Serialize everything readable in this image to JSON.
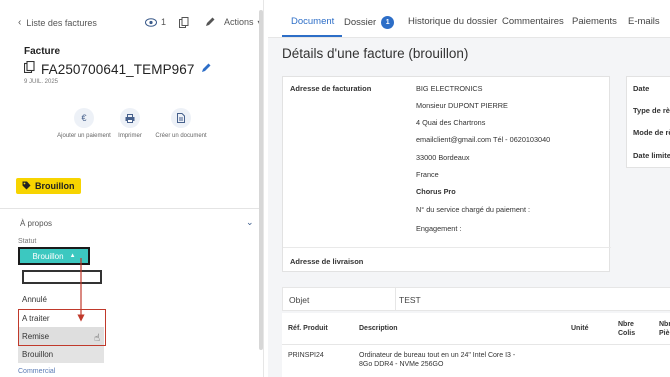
{
  "left": {
    "back_label": "Liste des factures",
    "followers_count": "1",
    "actions_label": "Actions",
    "invoice_type": "Facture",
    "invoice_id": "FA250700641_TEMP967",
    "invoice_date": "9 JUIL. 2025",
    "quick_actions": [
      {
        "label": "Ajouter un paiement",
        "icon": "euro-icon"
      },
      {
        "label": "Imprimer",
        "icon": "printer-icon"
      },
      {
        "label": "Créer un document",
        "icon": "document-icon"
      }
    ],
    "status_badge": "Brouillon",
    "section_title": "À propos",
    "status_label": "Statut",
    "status_value": "Brouillon",
    "status_options": [
      "Annulé",
      "A traiter",
      "Remise",
      "Brouillon"
    ],
    "next_section": "Commercial"
  },
  "tabs": [
    {
      "label": "Document",
      "active": true
    },
    {
      "label": "Dossier",
      "count": "1"
    },
    {
      "label": "Historique du dossier"
    },
    {
      "label": "Commentaires"
    },
    {
      "label": "Paiements"
    },
    {
      "label": "E-mails"
    }
  ],
  "page_title": "Détails d'une facture (brouillon)",
  "billing": {
    "label": "Adresse de facturation",
    "company": "BIG ELECTRONICS",
    "contact": "Monsieur DUPONT PIERRE",
    "street": "4 Quai des Chartrons",
    "email_phone": "emailclient@gmail.com Tél - 0620103040",
    "city": "33000 Bordeaux",
    "country": "France",
    "chorus": "Chorus Pro",
    "service_label": "N° du service chargé du paiement :",
    "engagement_label": "Engagement :"
  },
  "delivery_label": "Adresse de livraison",
  "side_fields": [
    "Date",
    "Type de règ",
    "Mode de rè",
    "Date limite"
  ],
  "objet": {
    "label": "Objet",
    "value": "TEST"
  },
  "table": {
    "headers": [
      "Réf. Produit",
      "Description",
      "Unité",
      "Nbre Colis",
      "Nbre Piè"
    ],
    "rows": [
      {
        "ref": "PRINSPI24",
        "description": "Ordinateur de bureau tout en un 24\" Intel Core I3 - 8Go DDR4 - NVMe 256GO"
      }
    ]
  },
  "colors": {
    "accent": "#2d6ec7",
    "status_teal": "#3cc8c0",
    "badge_yellow": "#f7d400",
    "highlight_red": "#c0392b"
  }
}
